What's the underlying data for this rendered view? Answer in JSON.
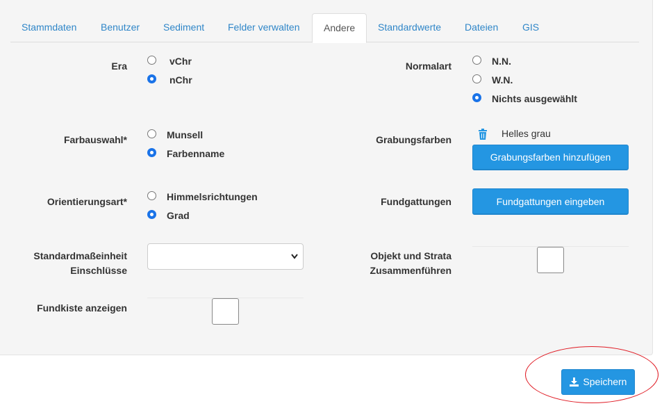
{
  "tabs": [
    {
      "label": "Stammdaten"
    },
    {
      "label": "Benutzer"
    },
    {
      "label": "Sediment"
    },
    {
      "label": "Felder verwalten"
    },
    {
      "label": "Andere",
      "active": true
    },
    {
      "label": "Standardwerte"
    },
    {
      "label": "Dateien"
    },
    {
      "label": "GIS"
    }
  ],
  "era": {
    "label": "Era",
    "options": [
      "vChr",
      "nChr"
    ],
    "selected": "nChr"
  },
  "normalart": {
    "label": "Normalart",
    "options": [
      "N.N.",
      "W.N.",
      "Nichts ausgewählt"
    ],
    "selected": "Nichts ausgewählt"
  },
  "farbauswahl": {
    "label": "Farbauswahl*",
    "options": [
      "Munsell",
      "Farbenname"
    ],
    "selected": "Farbenname"
  },
  "grabungsfarben": {
    "label": "Grabungsfarben",
    "item": "Helles grau",
    "add_button": "Grabungsfarben hinzufügen"
  },
  "orientierungsart": {
    "label": "Orientierungsart*",
    "options": [
      "Himmelsrichtungen",
      "Grad"
    ],
    "selected": "Grad"
  },
  "fundgattungen": {
    "label": "Fundgattungen",
    "button": "Fundgattungen eingeben"
  },
  "standardmass": {
    "label_line1": "Standardmaßeinheit",
    "label_line2": "Einschlüsse",
    "value": ""
  },
  "objekt_strata": {
    "label_line1": "Objekt und Strata",
    "label_line2": "Zusammenführen",
    "checked": false
  },
  "fundkiste": {
    "label": "Fundkiste anzeigen",
    "checked": false
  },
  "save": {
    "label": "Speichern"
  },
  "colors": {
    "accent": "#2496e2",
    "link": "#2f86c8",
    "annotation": "#e01b24"
  }
}
